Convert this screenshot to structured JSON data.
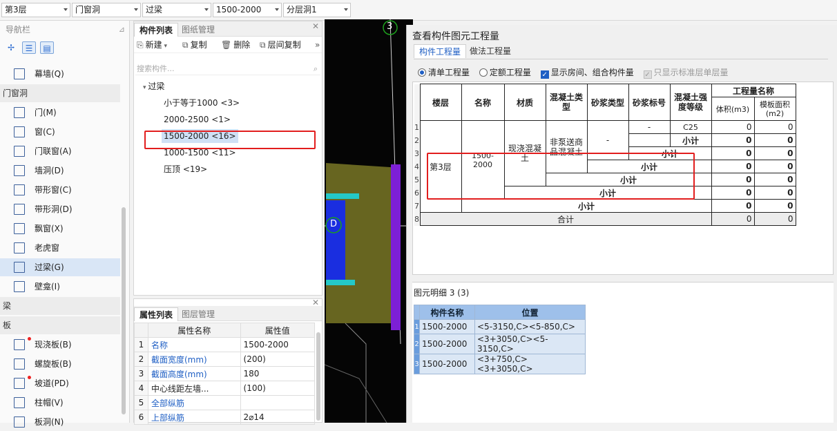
{
  "toolbar": {
    "floor": "第3层",
    "category": "门窗洞",
    "type": "过梁",
    "component": "1500-2000",
    "layer": "分层洞1"
  },
  "nav": {
    "title": "导航栏",
    "items": [
      {
        "label": "幕墙(Q)",
        "kind": "item"
      },
      {
        "label": "门窗洞",
        "kind": "cat"
      },
      {
        "label": "门(M)",
        "kind": "item"
      },
      {
        "label": "窗(C)",
        "kind": "item"
      },
      {
        "label": "门联窗(A)",
        "kind": "item"
      },
      {
        "label": "墙洞(D)",
        "kind": "item"
      },
      {
        "label": "带形窗(C)",
        "kind": "item"
      },
      {
        "label": "带形洞(D)",
        "kind": "item"
      },
      {
        "label": "飘窗(X)",
        "kind": "item"
      },
      {
        "label": "老虎窗",
        "kind": "item"
      },
      {
        "label": "过梁(G)",
        "kind": "item",
        "selected": true
      },
      {
        "label": "壁龛(I)",
        "kind": "item"
      },
      {
        "label": "梁",
        "kind": "cat"
      },
      {
        "label": "板",
        "kind": "cat"
      },
      {
        "label": "现浇板(B)",
        "kind": "item",
        "dot": true
      },
      {
        "label": "螺旋板(B)",
        "kind": "item"
      },
      {
        "label": "坡道(PD)",
        "kind": "item",
        "dot": true
      },
      {
        "label": "柱帽(V)",
        "kind": "item"
      },
      {
        "label": "板洞(N)",
        "kind": "item"
      }
    ]
  },
  "complist": {
    "tabs": [
      "构件列表",
      "图纸管理"
    ],
    "toolbar": {
      "new": "新建",
      "copy": "复制",
      "delete": "删除",
      "floor_copy": "层间复制"
    },
    "search_placeholder": "搜索构件...",
    "root": "过梁",
    "items": [
      {
        "label": "小于等于1000 <3>"
      },
      {
        "label": "2000-2500 <1>"
      },
      {
        "label": "1500-2000 <16>",
        "selected": true
      },
      {
        "label": "1000-1500 <11>"
      },
      {
        "label": "压顶 <19>"
      }
    ]
  },
  "props": {
    "tabs": [
      "属性列表",
      "图层管理"
    ],
    "headers": [
      "属性名称",
      "属性值"
    ],
    "rows": [
      {
        "n": "1",
        "name": "名称",
        "value": "1500-2000",
        "blue": true
      },
      {
        "n": "2",
        "name": "截面宽度(mm)",
        "value": "(200)",
        "blue": true
      },
      {
        "n": "3",
        "name": "截面高度(mm)",
        "value": "180",
        "blue": true
      },
      {
        "n": "4",
        "name": "中心线距左墙...",
        "value": "(100)",
        "blue": false
      },
      {
        "n": "5",
        "name": "全部纵筋",
        "value": "",
        "blue": true
      },
      {
        "n": "6",
        "name": "上部纵筋",
        "value": "2⌀14",
        "blue": true
      }
    ]
  },
  "canvas": {
    "axis_3": "3",
    "axis_d": "D"
  },
  "dialog": {
    "title": "查看构件图元工程量",
    "tabs": [
      "构件工程量",
      "做法工程量"
    ],
    "options": {
      "bill": "清单工程量",
      "quota": "定额工程量",
      "show_room": "显示房间、组合构件量",
      "std_only": "只显示标准层单层量"
    },
    "qty_headers": {
      "floor": "楼层",
      "name": "名称",
      "material": "材质",
      "concrete_type": "混凝土类型",
      "mortar_type": "砂浆类型",
      "mortar_grade": "砂浆标号",
      "strength": "混凝土强度等级",
      "qty_group": "工程量名称",
      "volume": "体积(m3)",
      "formwork": "模板面积(m2)"
    },
    "qty_rows": {
      "floor": "第3层",
      "name": "1500-2000",
      "material": "现浇混凝土",
      "concrete_type": "非泵送商品混凝土",
      "mortar_type": "-",
      "mortar_grade": "-",
      "strength": "C25",
      "subtotal": "小计",
      "total": "合计",
      "zero": "0"
    },
    "row_numbers": [
      "1",
      "2",
      "3",
      "4",
      "5",
      "6",
      "7",
      "8"
    ],
    "detail_label": "图元明细",
    "detail_count": "3 (3)",
    "detail_headers": [
      "构件名称",
      "位置"
    ],
    "detail_rows": [
      {
        "n": "1",
        "name": "1500-2000",
        "pos": "<5-3150,C><5-850,C>"
      },
      {
        "n": "2",
        "name": "1500-2000",
        "pos": "<3+3050,C><5-3150,C>"
      },
      {
        "n": "3",
        "name": "1500-2000",
        "pos": "<3+750,C><3+3050,C>"
      }
    ]
  }
}
